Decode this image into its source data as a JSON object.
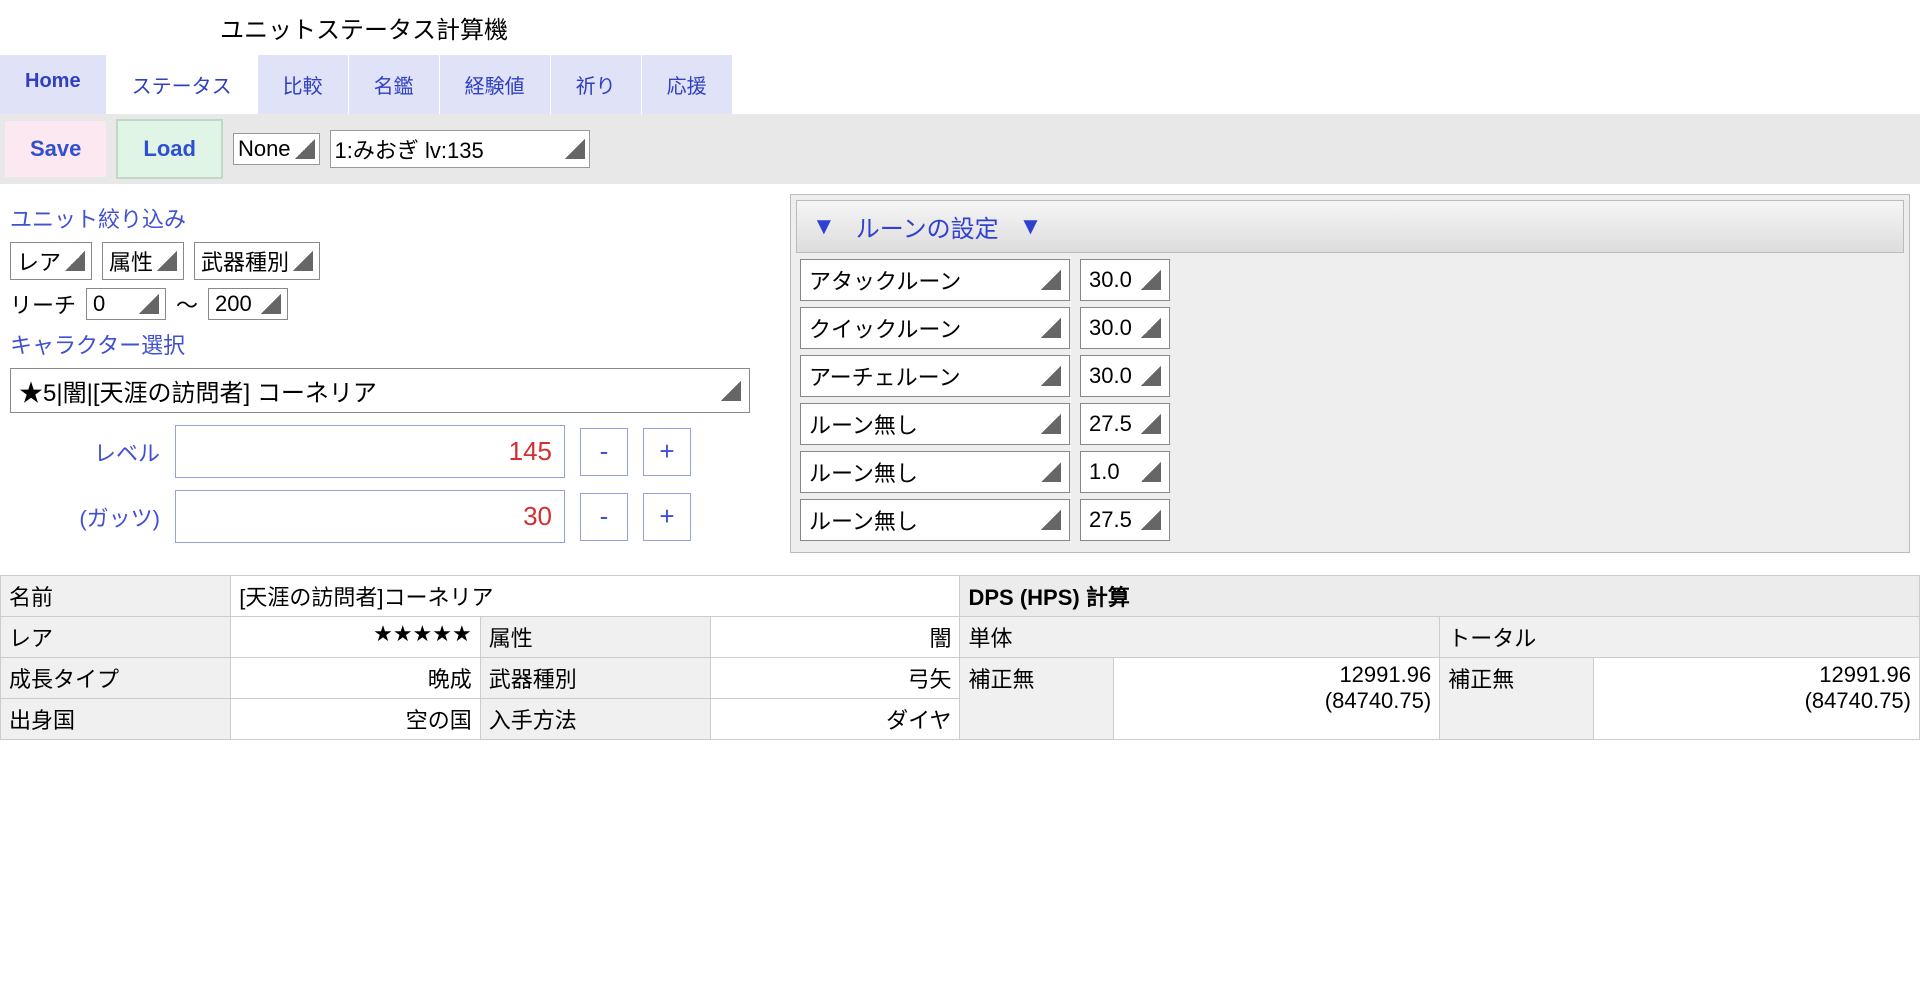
{
  "title": "ユニットステータス計算機",
  "tabs": [
    "Home",
    "ステータス",
    "比較",
    "名鑑",
    "経験値",
    "祈り",
    "応援"
  ],
  "active_tab_index": 1,
  "toolbar": {
    "save": "Save",
    "load": "Load",
    "slot": "None",
    "preset": "1:みおぎ lv:135"
  },
  "filter": {
    "title": "ユニット絞り込み",
    "rare": "レア",
    "attr": "属性",
    "weapon": "武器種別",
    "reach_label": "リーチ",
    "reach_min": "0",
    "reach_tilde": "〜",
    "reach_max": "200"
  },
  "char_select": {
    "label": "キャラクター選択",
    "value": "★5|闇|[天涯の訪問者] コーネリア"
  },
  "level": {
    "label": "レベル",
    "value": "145",
    "minus": "-",
    "plus": "+"
  },
  "guts": {
    "label": "(ガッツ)",
    "value": "30",
    "minus": "-",
    "plus": "+"
  },
  "rune": {
    "header": "ルーンの設定",
    "rows": [
      {
        "name": "アタックルーン",
        "val": "30.0"
      },
      {
        "name": "クイックルーン",
        "val": "30.0"
      },
      {
        "name": "アーチェルーン",
        "val": "30.0"
      },
      {
        "name": "ルーン無し",
        "val": "27.5"
      },
      {
        "name": "ルーン無し",
        "val": "1.0"
      },
      {
        "name": "ルーン無し",
        "val": "27.5"
      }
    ]
  },
  "stats": {
    "name_label": "名前",
    "name_value": "[天涯の訪問者]コーネリア",
    "rare_label": "レア",
    "rare_value": "★★★★★",
    "attr_label": "属性",
    "attr_value": "闇",
    "growth_label": "成長タイプ",
    "growth_value": "晩成",
    "weapon_label": "武器種別",
    "weapon_value": "弓矢",
    "country_label": "出身国",
    "country_value": "空の国",
    "obtain_label": "入手方法",
    "obtain_value": "ダイヤ"
  },
  "dps": {
    "header": "DPS (HPS) 計算",
    "single": "単体",
    "total": "トータル",
    "nomod": "補正無",
    "v1": "12991.96",
    "v1sub": "(84740.75)",
    "v2": "12991.96",
    "v2sub": "(84740.75)"
  }
}
